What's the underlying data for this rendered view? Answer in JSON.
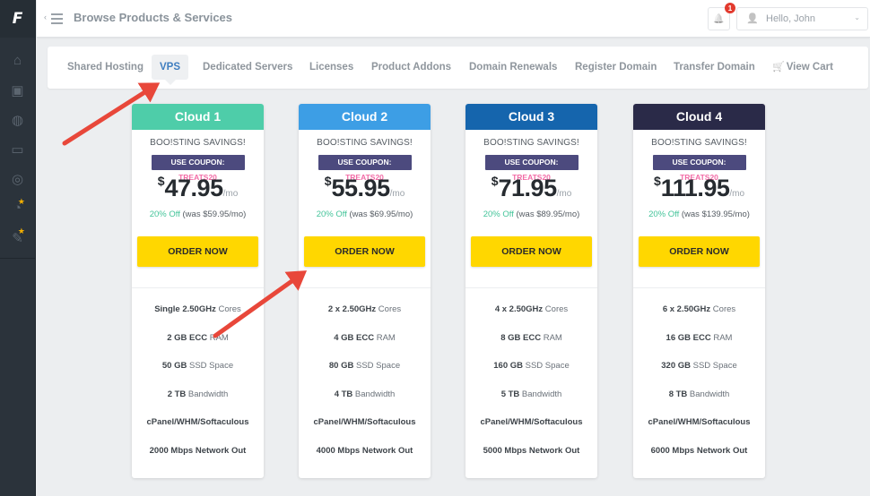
{
  "sidebar": {
    "logo": "F",
    "items": [
      {
        "icon": "home-icon",
        "glyph": "⌂",
        "star": false
      },
      {
        "icon": "box-icon",
        "glyph": "▣",
        "star": false
      },
      {
        "icon": "globe-icon",
        "glyph": "◍",
        "star": false
      },
      {
        "icon": "credit-card-icon",
        "glyph": "▭",
        "star": false
      },
      {
        "icon": "lifebuoy-icon",
        "glyph": "◎",
        "star": false
      },
      {
        "icon": "dashboard-icon",
        "glyph": "◔",
        "star": true
      },
      {
        "icon": "edit-icon",
        "glyph": "✎",
        "star": true
      }
    ],
    "star_glyph": "★"
  },
  "header": {
    "collapse_glyph": "‹",
    "title": "Browse Products & Services",
    "notifications_count": "1",
    "bell_glyph": "🔔",
    "user_glyph": "👤",
    "user_label": "Hello, John",
    "caret_glyph": "⌄"
  },
  "tabs": [
    {
      "label": "Shared Hosting",
      "active": false
    },
    {
      "label": "VPS",
      "active": true
    },
    {
      "label": "Dedicated Servers",
      "active": false
    },
    {
      "label": "Licenses",
      "active": false
    },
    {
      "label": "Product Addons",
      "active": false
    },
    {
      "label": "Domain Renewals",
      "active": false
    },
    {
      "label": "Register Domain",
      "active": false
    },
    {
      "label": "Transfer Domain",
      "active": false
    },
    {
      "label": "View Cart",
      "active": false,
      "icon": "🛒"
    }
  ],
  "plans": [
    {
      "name": "Cloud 1",
      "color": "#4ecda9",
      "tagline": "BOO!STING SAVINGS!",
      "coupon_label": "USE COUPON:",
      "coupon_code": "TREATS20",
      "currency": "$",
      "price": "47.95",
      "period": "/mo",
      "discount": "20% Off",
      "was": "(was $59.95/mo)",
      "order_label": "ORDER NOW",
      "specs": [
        {
          "bold": "Single 2.50GHz",
          "text": " Cores"
        },
        {
          "bold": "2 GB ECC",
          "text": " RAM"
        },
        {
          "bold": "50 GB",
          "text": " SSD Space"
        },
        {
          "bold": "2 TB",
          "text": " Bandwidth"
        },
        {
          "bold": "cPanel/WHM/Softaculous",
          "text": ""
        },
        {
          "bold": "2000 Mbps Network Out",
          "text": ""
        }
      ]
    },
    {
      "name": "Cloud 2",
      "color": "#3d9ee5",
      "tagline": "BOO!STING SAVINGS!",
      "coupon_label": "USE COUPON:",
      "coupon_code": "TREATS20",
      "currency": "$",
      "price": "55.95",
      "period": "/mo",
      "discount": "20% Off",
      "was": "(was $69.95/mo)",
      "order_label": "ORDER NOW",
      "specs": [
        {
          "bold": "2 x 2.50GHz",
          "text": " Cores"
        },
        {
          "bold": "4 GB ECC",
          "text": " RAM"
        },
        {
          "bold": "80 GB",
          "text": " SSD Space"
        },
        {
          "bold": "4 TB",
          "text": " Bandwidth"
        },
        {
          "bold": "cPanel/WHM/Softaculous",
          "text": ""
        },
        {
          "bold": "4000 Mbps Network Out",
          "text": ""
        }
      ]
    },
    {
      "name": "Cloud 3",
      "color": "#1565ad",
      "tagline": "BOO!STING SAVINGS!",
      "coupon_label": "USE COUPON:",
      "coupon_code": "TREATS20",
      "currency": "$",
      "price": "71.95",
      "period": "/mo",
      "discount": "20% Off",
      "was": "(was $89.95/mo)",
      "order_label": "ORDER NOW",
      "specs": [
        {
          "bold": "4 x 2.50GHz",
          "text": " Cores"
        },
        {
          "bold": "8 GB ECC",
          "text": " RAM"
        },
        {
          "bold": "160 GB",
          "text": " SSD Space"
        },
        {
          "bold": "5 TB",
          "text": " Bandwidth"
        },
        {
          "bold": "cPanel/WHM/Softaculous",
          "text": ""
        },
        {
          "bold": "5000 Mbps Network Out",
          "text": ""
        }
      ]
    },
    {
      "name": "Cloud 4",
      "color": "#2a2a48",
      "tagline": "BOO!STING SAVINGS!",
      "coupon_label": "USE COUPON:",
      "coupon_code": "TREATS20",
      "currency": "$",
      "price": "111.95",
      "period": "/mo",
      "discount": "20% Off",
      "was": "(was $139.95/mo)",
      "order_label": "ORDER NOW",
      "specs": [
        {
          "bold": "6 x 2.50GHz",
          "text": " Cores"
        },
        {
          "bold": "16 GB ECC",
          "text": " RAM"
        },
        {
          "bold": "320 GB",
          "text": " SSD Space"
        },
        {
          "bold": "8 TB",
          "text": " Bandwidth"
        },
        {
          "bold": "cPanel/WHM/Softaculous",
          "text": ""
        },
        {
          "bold": "6000 Mbps Network Out",
          "text": ""
        }
      ]
    }
  ],
  "annotations": {
    "arrow_color": "#e8473a"
  }
}
